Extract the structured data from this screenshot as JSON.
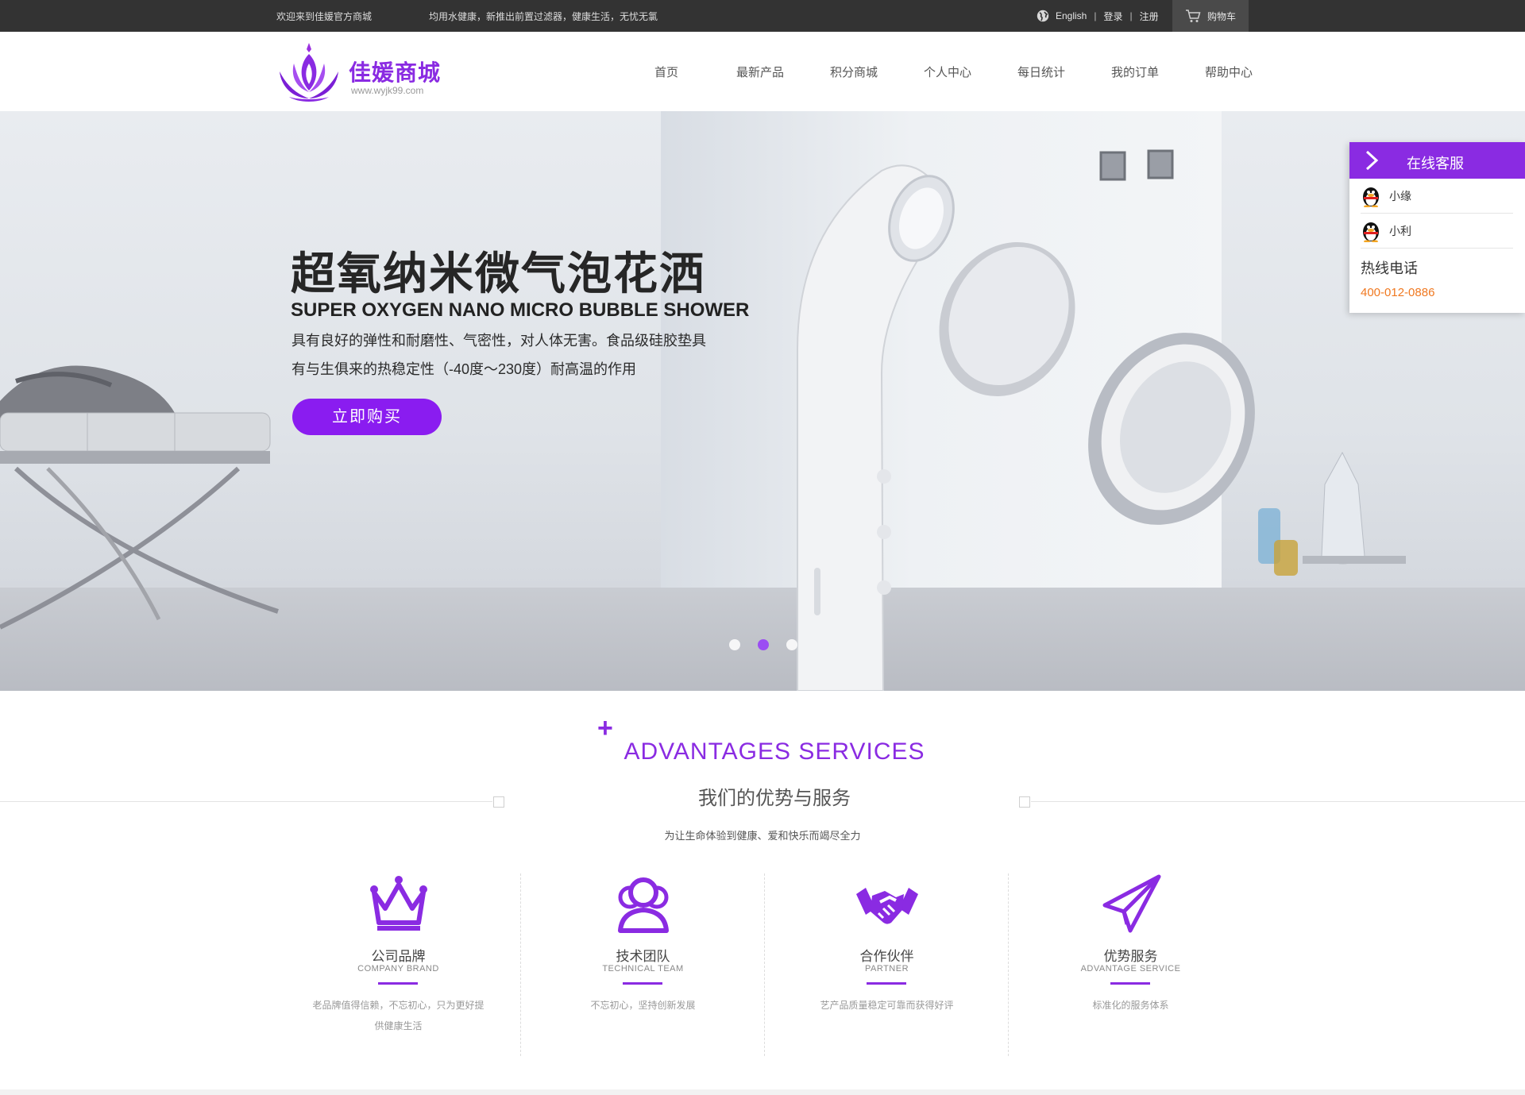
{
  "topbar": {
    "welcome": "欢迎来到佳媛官方商城",
    "notice": "均用水健康，新推出前置过滤器，健康生活，无忧无氯",
    "lang": "English",
    "login": "登录",
    "register": "注册",
    "cart": "购物车",
    "separator": "|"
  },
  "header": {
    "brand": "佳媛商城",
    "url": "www.wyjk99.com",
    "nav": [
      "首页",
      "最新产品",
      "积分商城",
      "个人中心",
      "每日统计",
      "我的订单",
      "帮助中心"
    ]
  },
  "banner": {
    "title_cn": "超氧纳米微气泡花洒",
    "title_en": "SUPER OXYGEN NANO MICRO BUBBLE SHOWER",
    "desc1": "具有良好的弹性和耐磨性、气密性，对人体无害。食品级硅胶垫具",
    "desc2": "有与生俱来的热稳定性（-40度～230度）耐高温的作用",
    "button": "立即购买",
    "slide_count": 3,
    "active_slide": 2
  },
  "service": {
    "title": "在线客服",
    "agents": [
      "小缘",
      "小利"
    ],
    "hotline_label": "热线电话",
    "hotline": "400-012-0886"
  },
  "advantages": {
    "plus": "+",
    "title_en": "ADVANTAGES SERVICES",
    "title_cn": "我们的优势与服务",
    "subtitle": "为让生命体验到健康、爱和快乐而竭尽全力",
    "items": [
      {
        "name": "公司品牌",
        "en": "COMPANY BRAND",
        "desc": "老品牌值得信赖，不忘初心，只为更好提供健康生活",
        "icon": "crown-icon"
      },
      {
        "name": "技术团队",
        "en": "TECHNICAL TEAM",
        "desc": "不忘初心，坚持创新发展",
        "icon": "team-icon"
      },
      {
        "name": "合作伙伴",
        "en": "PARTNER",
        "desc": "艺产品质量稳定可靠而获得好评",
        "icon": "handshake-icon"
      },
      {
        "name": "优势服务",
        "en": "ADVANTAGE SERVICE",
        "desc": "标准化的服务体系",
        "icon": "paper-plane-icon"
      }
    ]
  },
  "colors": {
    "accent": "#8a2be2",
    "button": "#8a1cf0",
    "hotline": "#f07820",
    "topbar": "#333333"
  }
}
